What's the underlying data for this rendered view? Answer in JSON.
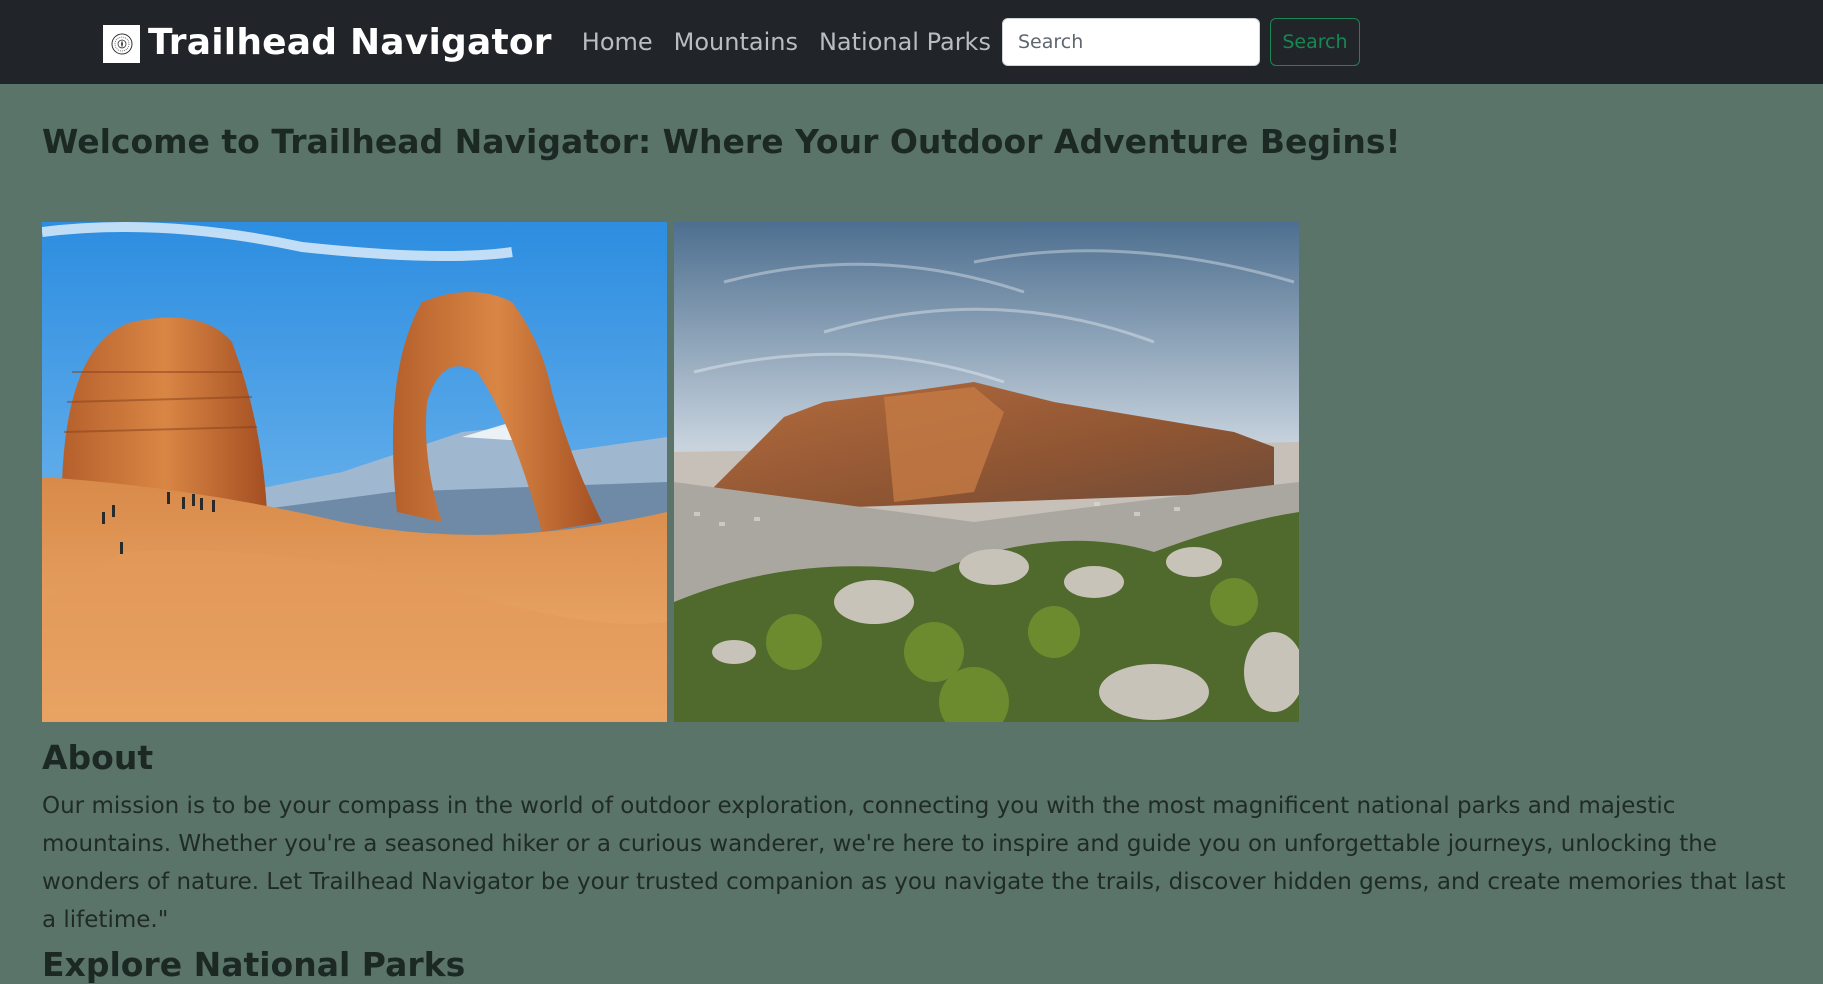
{
  "navbar": {
    "brand": "Trailhead Navigator",
    "logo_icon": "compass-seal-icon",
    "links": [
      "Home",
      "Mountains",
      "National Parks"
    ],
    "search": {
      "placeholder": "Search",
      "value": ""
    },
    "search_button": "Search"
  },
  "main": {
    "welcome_title": "Welcome to Trailhead Navigator: Where Your Outdoor Adventure Begins!",
    "images": [
      {
        "name": "delicate-arch-photo"
      },
      {
        "name": "table-mountain-photo"
      }
    ],
    "about": {
      "heading": "About",
      "text": "Our mission is to be your compass in the world of outdoor exploration, connecting you with the most magnificent national parks and majestic mountains. Whether you're a seasoned hiker or a curious wanderer, we're here to inspire and guide you on unforgettable journeys, unlocking the wonders of nature. Let Trailhead Navigator be your trusted companion as you navigate the trails, discover hidden gems, and create memories that last a lifetime.\""
    },
    "next_heading": "Explore National Parks"
  },
  "colors": {
    "navbar_bg": "#212529",
    "page_bg": "#5a7469",
    "search_button_accent": "#198754"
  }
}
